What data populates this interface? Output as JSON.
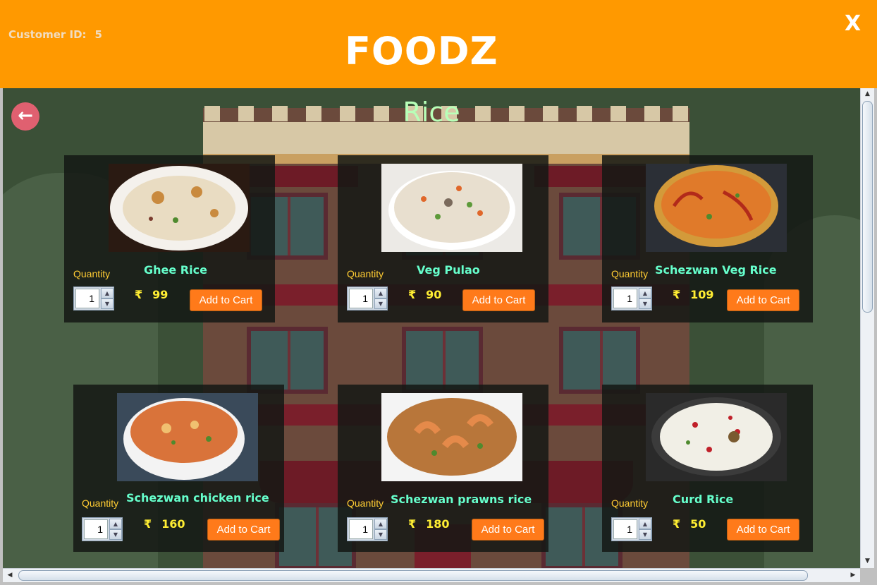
{
  "header": {
    "customer_label": "Customer ID:",
    "customer_id": "5",
    "app_title": "FOODZ",
    "close_label": "X"
  },
  "page": {
    "heading": "Rice",
    "back_icon": "arrow-left-icon",
    "back_symbol": "←"
  },
  "menu": [
    {
      "name": "Ghee Rice",
      "currency": "₹",
      "price": "99",
      "qty_label": "Quantity",
      "qty": "1",
      "button": "Add to Cart"
    },
    {
      "name": "Veg Pulao",
      "currency": "₹",
      "price": "90",
      "qty_label": "Quantity",
      "qty": "1",
      "button": "Add to Cart"
    },
    {
      "name": "Schezwan Veg Rice",
      "currency": "₹",
      "price": "109",
      "qty_label": "Quantity",
      "qty": "1",
      "button": "Add to Cart"
    },
    {
      "name": "Schezwan chicken rice",
      "currency": "₹",
      "price": "160",
      "qty_label": "Quantity",
      "qty": "1",
      "button": "Add to Cart"
    },
    {
      "name": "Schezwan prawns rice",
      "currency": "₹",
      "price": "180",
      "qty_label": "Quantity",
      "qty": "1",
      "button": "Add to Cart"
    },
    {
      "name": "Curd Rice",
      "currency": "₹",
      "price": "50",
      "qty_label": "Quantity",
      "qty": "1",
      "button": "Add to Cart"
    }
  ],
  "spinner_icons": {
    "up": "▲",
    "down": "▼"
  },
  "scroll_icons": {
    "up": "▲",
    "down": "▼",
    "left": "◀",
    "right": "▶"
  },
  "colors": {
    "header": "#ff9900",
    "heading": "#b8ffb8",
    "dish_name": "#66ffcc",
    "price": "#ffee33",
    "quantity": "#ffcc33",
    "button": "#ff7a1a"
  }
}
